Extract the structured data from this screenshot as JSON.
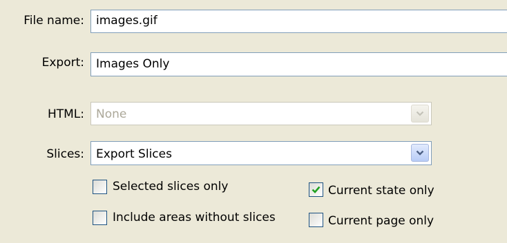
{
  "file_name": {
    "label": "File name:",
    "value": "images.gif"
  },
  "export": {
    "label": "Export:",
    "value": "Images Only"
  },
  "html": {
    "label": "HTML:",
    "value": "None",
    "disabled": true
  },
  "slices": {
    "label": "Slices:",
    "value": "Export Slices"
  },
  "options": {
    "selected_slices_only": {
      "label": "Selected slices only",
      "checked": false
    },
    "include_areas_without_slices": {
      "label": "Include areas without slices",
      "checked": false
    },
    "current_state_only": {
      "label": "Current state only",
      "checked": true
    },
    "current_page_only": {
      "label": "Current page only",
      "checked": false
    }
  },
  "icons": {
    "dropdown": "chevron-down-icon",
    "check": "checkmark-icon"
  },
  "colors": {
    "background": "#ece9d8",
    "border": "#7f9db9",
    "check": "#21a121",
    "chevron": "#4d6185"
  }
}
